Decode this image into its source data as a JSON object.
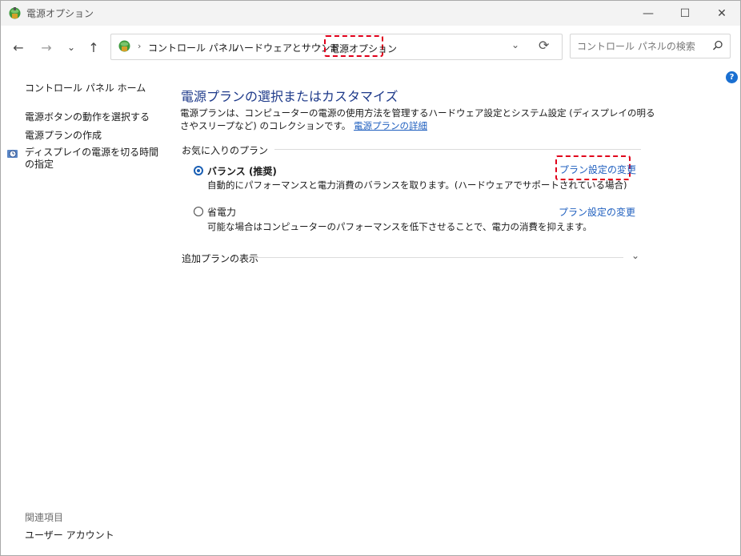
{
  "window": {
    "title": "電源オプション",
    "controls": {
      "minimize": "—",
      "maximize": "☐",
      "close": "✕"
    }
  },
  "navbar": {
    "back": "←",
    "forward": "→",
    "history": "⌄",
    "up": "↑",
    "breadcrumb": [
      "コントロール パネル",
      "ハードウェアとサウンド",
      "電源オプション"
    ],
    "separator": "›",
    "dropdown": "⌄",
    "refresh": "⟳",
    "search_placeholder": "コントロール パネルの検索"
  },
  "help": "?",
  "sidebar": {
    "home": "コントロール パネル ホーム",
    "links": [
      "電源ボタンの動作を選択する",
      "電源プランの作成",
      "ディスプレイの電源を切る時間の指定"
    ],
    "related_title": "関連項目",
    "related_links": [
      "ユーザー アカウント"
    ]
  },
  "main": {
    "title": "電源プランの選択またはカスタマイズ",
    "description": "電源プランは、コンピューターの電源の使用方法を管理するハードウェア設定とシステム設定 (ディスプレイの明るさやスリープなど) のコレクションです。",
    "description_link": "電源プランの詳細",
    "favorites_label": "お気に入りのプラン",
    "plans": [
      {
        "name": "バランス (推奨)",
        "selected": true,
        "description": "自動的にパフォーマンスと電力消費のバランスを取ります。(ハードウェアでサポートされている場合)",
        "link": "プラン設定の変更"
      },
      {
        "name": "省電力",
        "selected": false,
        "description": "可能な場合はコンピューターのパフォーマンスを低下させることで、電力の消費を抑えます。",
        "link": "プラン設定の変更"
      }
    ],
    "more_plans_label": "追加プランの表示",
    "more_plans_chevron": "⌄"
  },
  "colors": {
    "title": "#1e3a8a",
    "link": "#1f5fbf",
    "highlight": "#e0001b",
    "radio_selected": "#1a5fb4"
  }
}
